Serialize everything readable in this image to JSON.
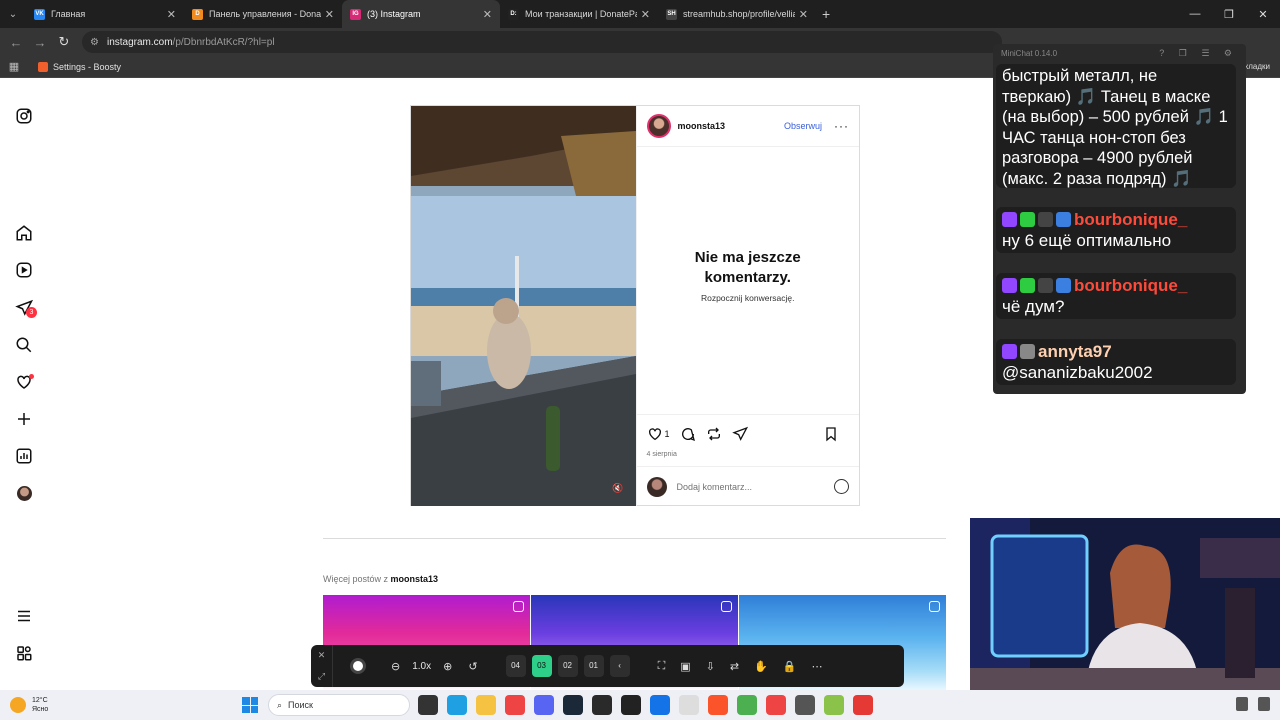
{
  "browser": {
    "tabs": [
      {
        "title": "Главная",
        "favicon": "VK",
        "color": "#2787f5",
        "active": false
      },
      {
        "title": "Панель управления - DonationAlerts",
        "favicon": "D",
        "color": "#f08c1f",
        "active": false
      },
      {
        "title": "(3) Instagram",
        "favicon": "IG",
        "color": "#d62976",
        "active": true
      },
      {
        "title": "Мои транзакции | DonatePay",
        "favicon": "D:",
        "color": "#222222",
        "active": false
      },
      {
        "title": "streamhub.shop/profile/vellialina",
        "favicon": "SH",
        "color": "#444444",
        "active": false
      }
    ],
    "url_host": "instagram.com",
    "url_path": "/p/DbnrbdAtKcR/?hl=pl",
    "bookmark": "Settings - Boosty",
    "bookmarks_right": "кладки"
  },
  "sidebar": {
    "notifications_count": "3"
  },
  "post": {
    "username": "moonsta13",
    "follow_label": "Obserwuj",
    "more_label": "···",
    "no_comments_title_line1": "Nie ma jeszcze",
    "no_comments_title_line2": "komentarzy.",
    "no_comments_sub": "Rozpocznij konwersację.",
    "likes": "1",
    "date": "4 sierpnia",
    "comment_placeholder": "Dodaj komentarz..."
  },
  "more_posts": {
    "prefix": "Więcej postów z",
    "username": "moonsta13"
  },
  "capture_toolbar": {
    "zoom": "1.0x",
    "steps": [
      "04",
      "03",
      "02",
      "01"
    ],
    "active_step": "03",
    "back_label": "‹"
  },
  "minichat": {
    "title": "MiniChat 0.14.0",
    "messages": [
      {
        "user": "",
        "text": "быстрый металл, не тверкаю) 🎵 Танец в маске (на выбор) – 500 рублей 🎵 1 ЧАС танца нон-стоп без разговора – 4900 рублей (макс. 2 раза подряд) 🎵"
      },
      {
        "user": "bourbonique_",
        "text": "ну 6 ещё оптимально"
      },
      {
        "user": "bourbonique_",
        "text": "чё дум?"
      },
      {
        "user": "annyta97",
        "text": "@sananizbaku2002"
      }
    ]
  },
  "taskbar": {
    "temperature": "12°C",
    "weather": "Ясно",
    "search_placeholder": "Поиск"
  }
}
